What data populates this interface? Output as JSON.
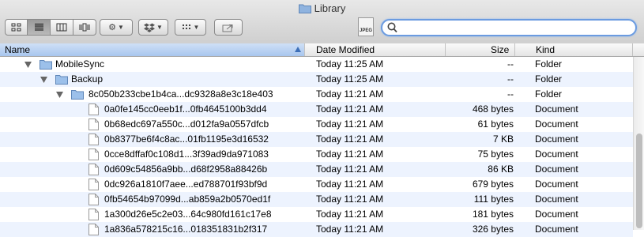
{
  "window": {
    "title": "Library"
  },
  "toolbar": {
    "view_buttons": [
      "icon-view-icon",
      "list-view-icon",
      "column-view-icon",
      "coverflow-view-icon"
    ],
    "search": {
      "value": "",
      "placeholder": ""
    },
    "preview_badge": "JPEG"
  },
  "columns": {
    "name": "Name",
    "date": "Date Modified",
    "size": "Size",
    "kind": "Kind"
  },
  "rows": [
    {
      "name": "MobileSync",
      "date": "Today 11:25 AM",
      "size": "--",
      "kind": "Folder"
    },
    {
      "name": "Backup",
      "date": "Today 11:25 AM",
      "size": "--",
      "kind": "Folder"
    },
    {
      "name": "8c050b233cbe1b4ca...dc9328a8e3c18e403",
      "date": "Today 11:21 AM",
      "size": "--",
      "kind": "Folder"
    },
    {
      "name": "0a0fe145cc0eeb1f...0fb4645100b3dd4",
      "date": "Today 11:21 AM",
      "size": "468 bytes",
      "kind": "Document"
    },
    {
      "name": "0b68edc697a550c...d012fa9a0557dfcb",
      "date": "Today 11:21 AM",
      "size": "61 bytes",
      "kind": "Document"
    },
    {
      "name": "0b8377be6f4c8ac...01fb1195e3d16532",
      "date": "Today 11:21 AM",
      "size": "7 KB",
      "kind": "Document"
    },
    {
      "name": "0cce8dffaf0c108d1...3f39ad9da971083",
      "date": "Today 11:21 AM",
      "size": "75 bytes",
      "kind": "Document"
    },
    {
      "name": "0d609c54856a9bb...d68f2958a88426b",
      "date": "Today 11:21 AM",
      "size": "86 KB",
      "kind": "Document"
    },
    {
      "name": "0dc926a1810f7aee...ed788701f93bf9d",
      "date": "Today 11:21 AM",
      "size": "679 bytes",
      "kind": "Document"
    },
    {
      "name": "0fb54654b97099d...ab859a2b0570ed1f",
      "date": "Today 11:21 AM",
      "size": "111 bytes",
      "kind": "Document"
    },
    {
      "name": "1a300d26e5c2e03...64c980fd161c17e8",
      "date": "Today 11:21 AM",
      "size": "181 bytes",
      "kind": "Document"
    },
    {
      "name": "1a836a578215c16...018351831b2f317",
      "date": "Today 11:21 AM",
      "size": "326 bytes",
      "kind": "Document"
    }
  ]
}
